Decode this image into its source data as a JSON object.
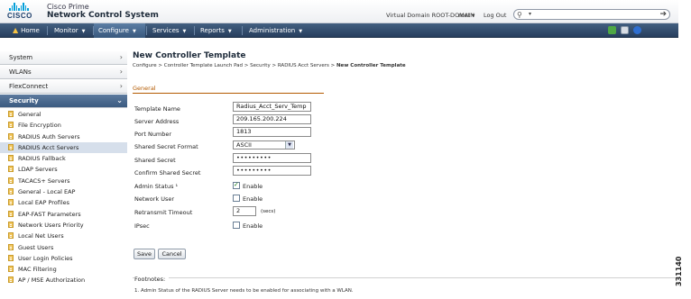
{
  "header": {
    "logo_text": "CISCO",
    "product_line1": "Cisco Prime",
    "product_line2": "Network Control System",
    "virtual_domain": "Virtual Domain ROOT-DOMAIN",
    "user": "root ▾",
    "logout": "Log Out",
    "search_placeholder": ""
  },
  "nav": {
    "home": "Home",
    "items": [
      "Monitor",
      "Configure",
      "Services",
      "Reports",
      "Administration"
    ],
    "active": "Configure"
  },
  "sidebar": {
    "menus": [
      "System",
      "WLANs",
      "FlexConnect",
      "Security"
    ],
    "expanded": "Security",
    "items": [
      "General",
      "File Encryption",
      "RADIUS Auth Servers",
      "RADIUS Acct Servers",
      "RADIUS Fallback",
      "LDAP Servers",
      "TACACS+ Servers",
      "General - Local EAP",
      "Local EAP Profiles",
      "EAP-FAST Parameters",
      "Network Users Priority",
      "Local Net Users",
      "Guest Users",
      "User Login Policies",
      "MAC Filtering",
      "AP / MSE Authorization"
    ],
    "selected": "RADIUS Acct Servers"
  },
  "main": {
    "title": "New Controller Template",
    "breadcrumb": [
      "Configure >",
      "Controller Template Launch Pad >",
      "Security >",
      "RADIUS Acct Servers >",
      "New Controller Template"
    ],
    "section": "General",
    "fields": {
      "template_name": {
        "label": "Template Name",
        "value": "Radius_Acct_Serv_Temp"
      },
      "server_address": {
        "label": "Server Address",
        "value": "209.165.200.224"
      },
      "port_number": {
        "label": "Port Number",
        "value": "1813"
      },
      "shared_secret_format": {
        "label": "Shared Secret Format",
        "value": "ASCII"
      },
      "shared_secret": {
        "label": "Shared Secret",
        "value": "•••••••••"
      },
      "confirm_shared_secret": {
        "label": "Confirm Shared Secret",
        "value": "•••••••••"
      },
      "admin_status": {
        "label": "Admin Status ¹",
        "option": "Enable",
        "checked": true
      },
      "network_user": {
        "label": "Network User",
        "option": "Enable",
        "checked": false
      },
      "retransmit_timeout": {
        "label": "Retransmit Timeout",
        "value": "2",
        "unit": "(secs)"
      },
      "ipsec": {
        "label": "IPsec",
        "option": "Enable",
        "checked": false
      }
    },
    "buttons": {
      "save": "Save",
      "cancel": "Cancel"
    },
    "footnotes_title": "Footnotes:",
    "footnote_1": "1. Admin Status of the RADIUS Server needs to be enabled for associating with a WLAN."
  },
  "figure_id": "331140",
  "colors": {
    "nav_bg": "#2f4a6b",
    "accent_orange": "#b35a00",
    "selected_row": "#d6dfeb"
  }
}
